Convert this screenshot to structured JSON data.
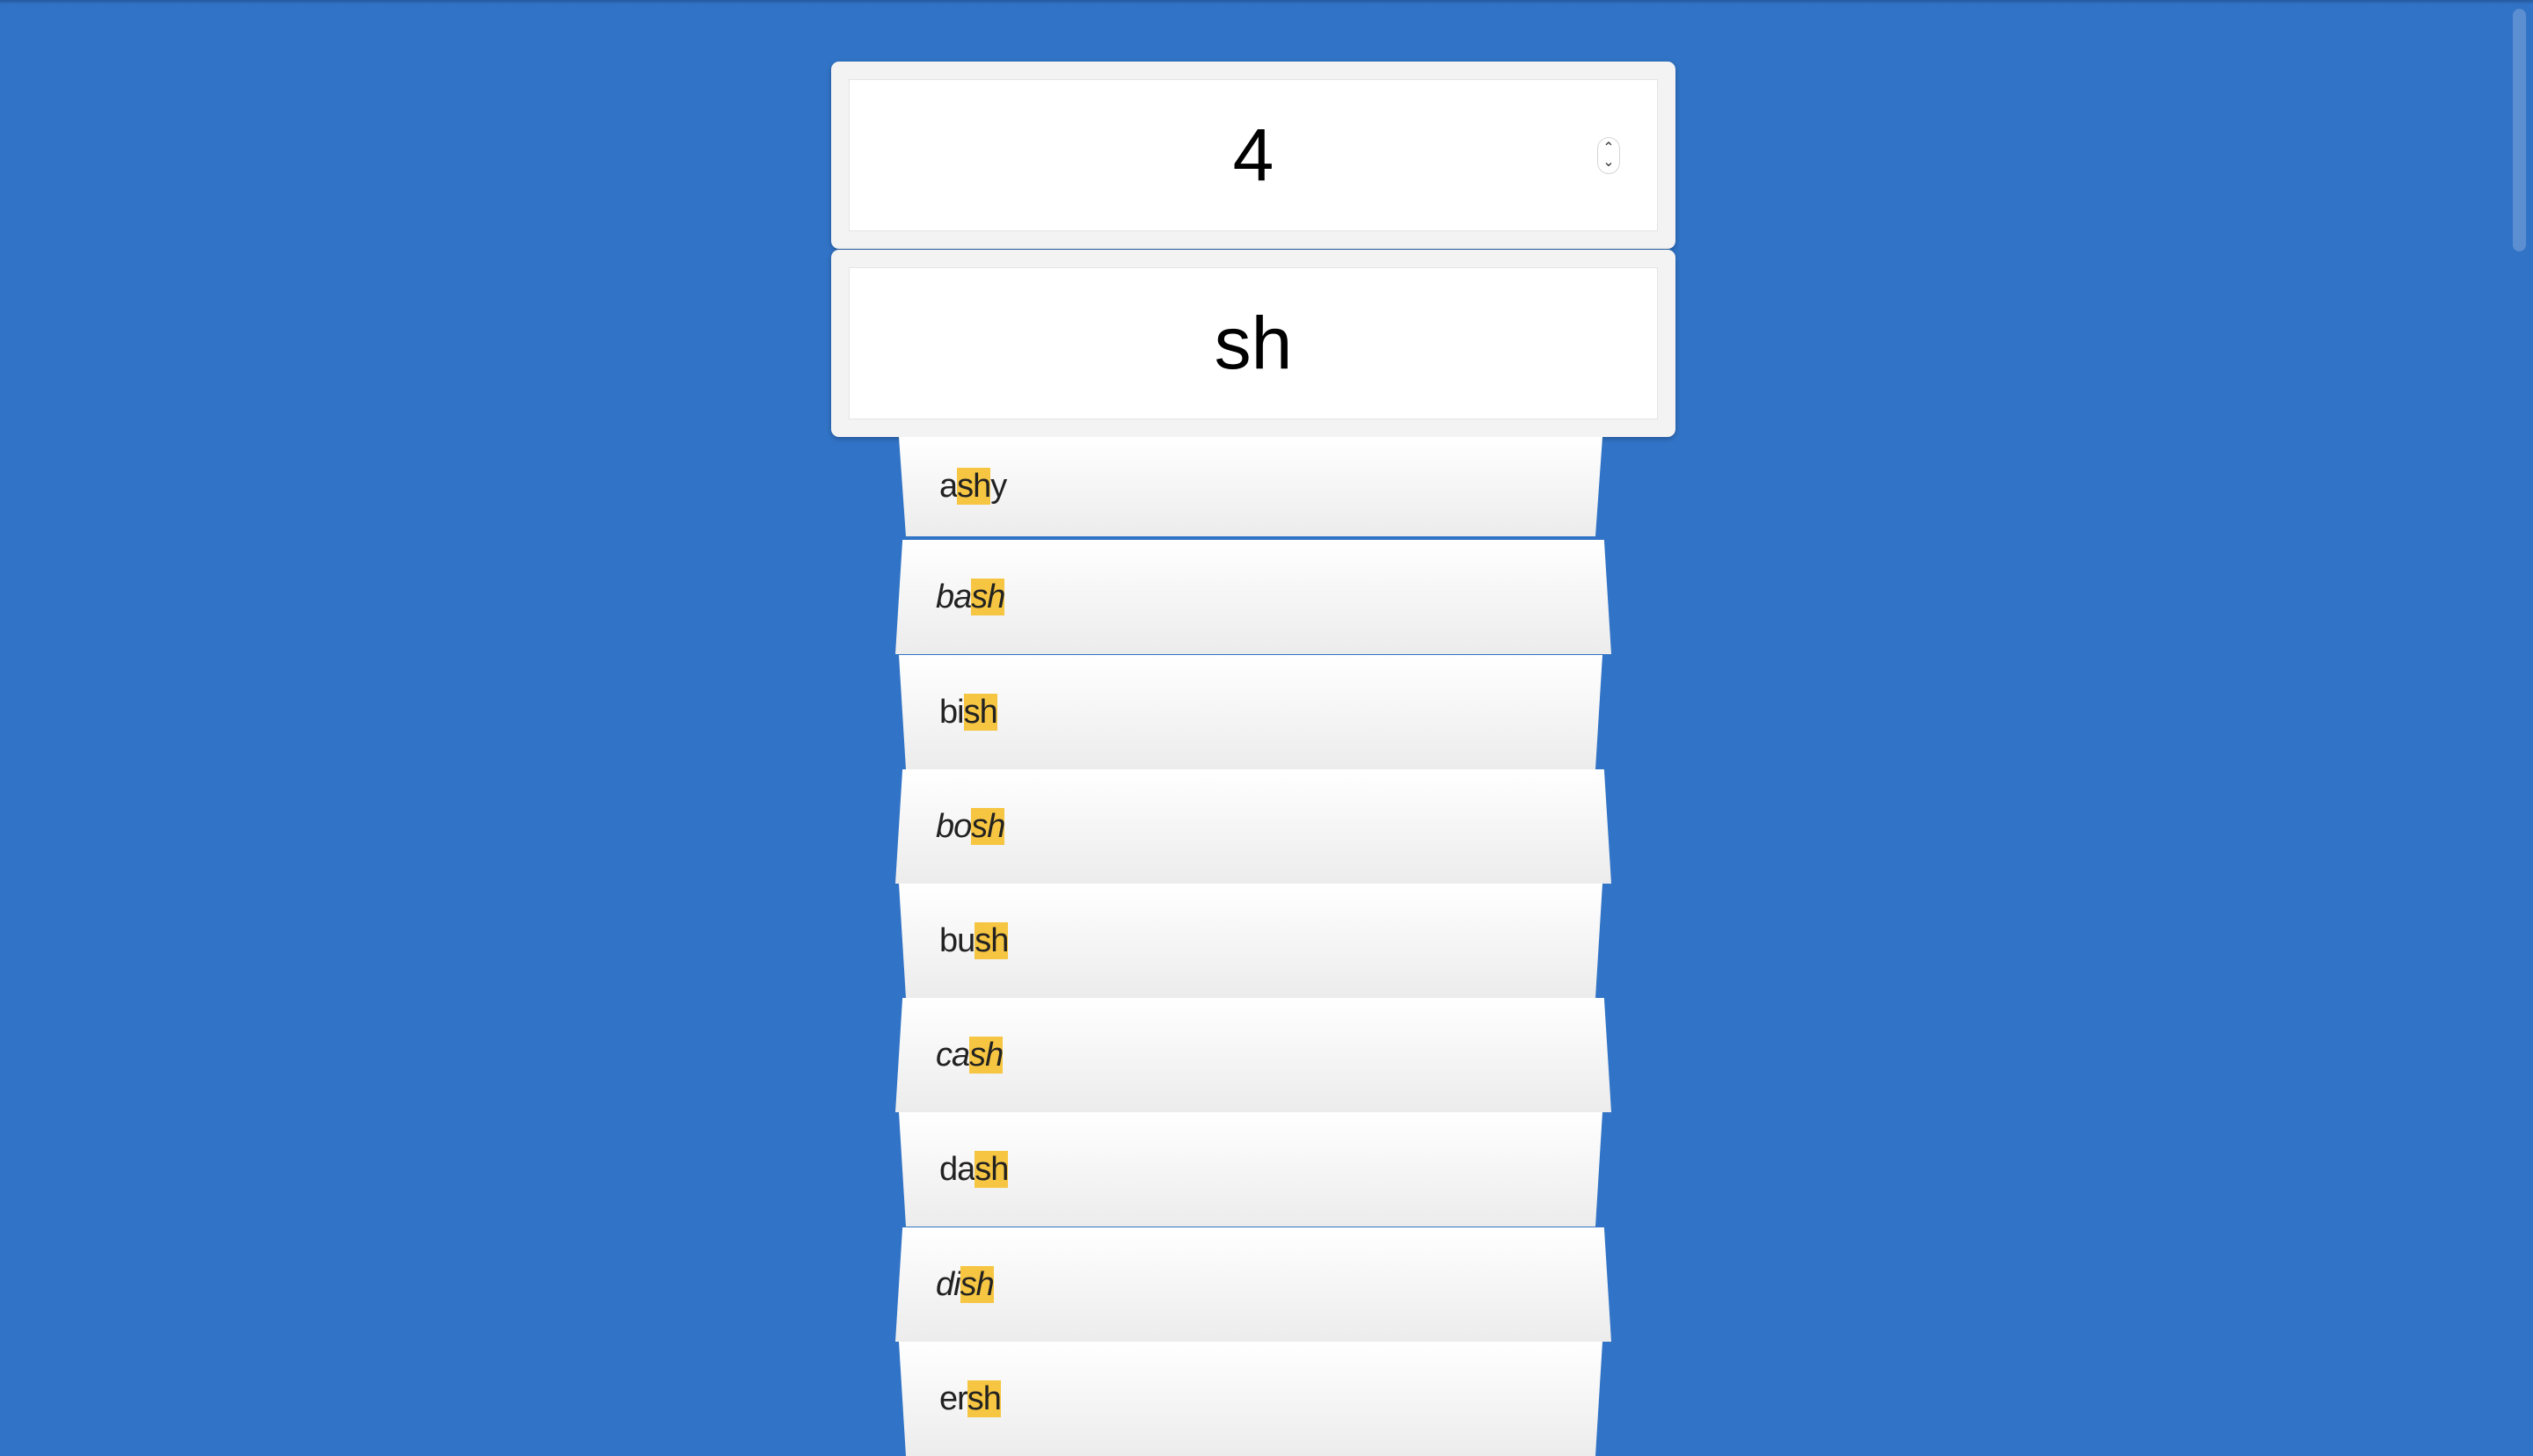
{
  "length_input": {
    "value": "4"
  },
  "pattern_input": {
    "value": "sh"
  },
  "results": [
    {
      "pre": "a",
      "match": "sh",
      "post": "y",
      "italic": false
    },
    {
      "pre": "ba",
      "match": "sh",
      "post": "",
      "italic": true
    },
    {
      "pre": "bi",
      "match": "sh",
      "post": "",
      "italic": false
    },
    {
      "pre": "bo",
      "match": "sh",
      "post": "",
      "italic": true
    },
    {
      "pre": "bu",
      "match": "sh",
      "post": "",
      "italic": false
    },
    {
      "pre": "ca",
      "match": "sh",
      "post": "",
      "italic": true
    },
    {
      "pre": "da",
      "match": "sh",
      "post": "",
      "italic": false
    },
    {
      "pre": "di",
      "match": "sh",
      "post": "",
      "italic": true
    },
    {
      "pre": "er",
      "match": "sh",
      "post": "",
      "italic": false
    }
  ],
  "colors": {
    "background": "#3173c6",
    "highlight": "#f6c541"
  },
  "icons": {
    "spinner_up": "chevron-up-icon",
    "spinner_down": "chevron-down-icon"
  }
}
